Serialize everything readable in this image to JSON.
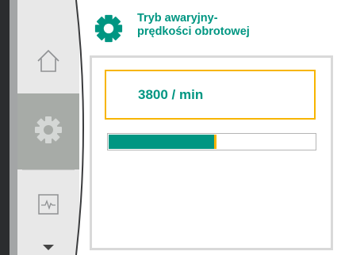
{
  "header": {
    "title_line1": "Tryb awaryjny-",
    "title_line2": "prędkości obrotowej",
    "icon": "gear-icon"
  },
  "sidebar": {
    "items": [
      {
        "icon": "home-icon",
        "active": false
      },
      {
        "icon": "settings-gear-icon",
        "active": true
      },
      {
        "icon": "diagnostics-waveform-icon",
        "active": false
      }
    ],
    "scroll_down_icon": "triangle-down-icon"
  },
  "main": {
    "value": "3800 / min",
    "progress": 0.51
  },
  "colors": {
    "accent": "#009682",
    "highlight": "#f7b500",
    "rail_bg": "#e8e8e8",
    "rail_active": "#a7aba7"
  }
}
